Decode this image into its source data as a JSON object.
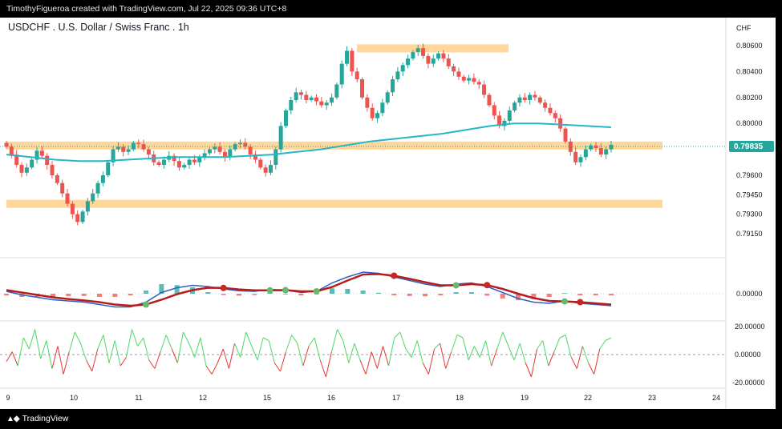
{
  "header": {
    "attribution": "TimothyFigueroa created with TradingView.com, Jul 22, 2025 09:36 UTC+8"
  },
  "footer": {
    "brand": "TradingView"
  },
  "chart_data": [
    {
      "type": "candlestick",
      "title": "USDCHF . U.S. Dollar / Swiss Franc . 1h",
      "currency_label": "CHF",
      "last_price_label": "0.79835",
      "y_tick_labels": [
        "0.80600",
        "0.80400",
        "0.80200",
        "0.80000",
        "0.79600",
        "0.79450",
        "0.79300",
        "0.79150"
      ],
      "x_tick_labels": [
        "9",
        "10",
        "11",
        "12",
        "15",
        "16",
        "17",
        "18",
        "19",
        "22",
        "23",
        "24"
      ],
      "ylim": [
        0.791,
        0.8068
      ],
      "colors": {
        "up": "#26a69a",
        "down": "#ef5350",
        "ma": "#26b7c7",
        "zone": "#ffd08a"
      },
      "zones": [
        [
          0.8057,
          0.8061
        ],
        [
          0.79805,
          0.7986
        ],
        [
          0.7937,
          0.7941
        ]
      ],
      "close": [
        0.7982,
        0.7976,
        0.7968,
        0.7962,
        0.7966,
        0.7972,
        0.7979,
        0.7975,
        0.7968,
        0.796,
        0.7954,
        0.7946,
        0.7938,
        0.793,
        0.7924,
        0.7932,
        0.794,
        0.7946,
        0.7954,
        0.796,
        0.797,
        0.798,
        0.7982,
        0.7978,
        0.798,
        0.7985,
        0.7984,
        0.798,
        0.7976,
        0.797,
        0.7968,
        0.7972,
        0.7975,
        0.7971,
        0.7966,
        0.7968,
        0.7972,
        0.797,
        0.7974,
        0.7977,
        0.798,
        0.7982,
        0.7978,
        0.7974,
        0.798,
        0.7984,
        0.7985,
        0.7982,
        0.7976,
        0.7972,
        0.7966,
        0.7962,
        0.7968,
        0.798,
        0.7998,
        0.801,
        0.8018,
        0.8024,
        0.8022,
        0.8018,
        0.802,
        0.8017,
        0.8014,
        0.8016,
        0.802,
        0.803,
        0.8046,
        0.8056,
        0.804,
        0.8034,
        0.802,
        0.8012,
        0.8004,
        0.8008,
        0.8016,
        0.8024,
        0.8034,
        0.804,
        0.8045,
        0.805,
        0.8055,
        0.8058,
        0.8052,
        0.8046,
        0.805,
        0.8054,
        0.805,
        0.8044,
        0.804,
        0.8036,
        0.8033,
        0.8035,
        0.8032,
        0.803,
        0.8022,
        0.8014,
        0.8006,
        0.7998,
        0.8002,
        0.801,
        0.8016,
        0.802,
        0.8018,
        0.8022,
        0.802,
        0.8016,
        0.8012,
        0.8008,
        0.8004,
        0.7996,
        0.7986,
        0.7978,
        0.797,
        0.7974,
        0.798,
        0.7983,
        0.7981,
        0.7976,
        0.798,
        0.79835
      ],
      "ma_values": [
        0.7976,
        0.7974,
        0.7972,
        0.7971,
        0.7971,
        0.7972,
        0.7973,
        0.7974,
        0.7974,
        0.7974,
        0.7975,
        0.7976,
        0.7978,
        0.798,
        0.7983,
        0.7986,
        0.7988,
        0.799,
        0.7992,
        0.7995,
        0.7998,
        0.8,
        0.8,
        0.7999,
        0.7998,
        0.7997
      ],
      "macd": [
        0.1,
        -0.05,
        -0.15,
        -0.25,
        -0.3,
        -0.35,
        -0.45,
        -0.55,
        -0.55,
        -0.35,
        0.05,
        0.25,
        0.35,
        0.3,
        0.2,
        0.12,
        0.1,
        0.18,
        0.15,
        0.05,
        0.1,
        0.45,
        0.7,
        0.9,
        0.85,
        0.7,
        0.55,
        0.4,
        0.3,
        0.4,
        0.45,
        0.3,
        0.05,
        -0.2,
        -0.35,
        -0.4,
        -0.3,
        -0.4,
        -0.45,
        -0.5
      ],
      "signal": [
        0.15,
        0.05,
        -0.05,
        -0.15,
        -0.22,
        -0.28,
        -0.35,
        -0.45,
        -0.5,
        -0.45,
        -0.25,
        -0.02,
        0.15,
        0.25,
        0.24,
        0.18,
        0.14,
        0.14,
        0.15,
        0.1,
        0.1,
        0.28,
        0.55,
        0.8,
        0.82,
        0.75,
        0.62,
        0.48,
        0.35,
        0.35,
        0.4,
        0.36,
        0.2,
        0.0,
        -0.18,
        -0.3,
        -0.32,
        -0.35,
        -0.4,
        -0.45
      ],
      "osc_axis_labels": [
        "20.00000",
        "0.00000",
        "-20.00000"
      ],
      "macd_axis_label": "0.00000",
      "oscillator": [
        -5,
        2,
        -8,
        12,
        4,
        18,
        -3,
        10,
        -10,
        6,
        -14,
        2,
        16,
        8,
        -4,
        -12,
        4,
        14,
        -6,
        10,
        -8,
        -2,
        18,
        6,
        12,
        -4,
        -10,
        2,
        14,
        4,
        -6,
        16,
        8,
        -2,
        12,
        -8,
        -14,
        -6,
        4,
        -10,
        8,
        -2,
        16,
        6,
        -4,
        12,
        10,
        -6,
        -12,
        2,
        14,
        8,
        -8,
        6,
        12,
        -4,
        -16,
        2,
        18,
        10,
        -6,
        8,
        -4,
        -14,
        2,
        -10,
        6,
        -8,
        12,
        16,
        4,
        -2,
        10,
        -6,
        -14,
        4,
        8,
        -10,
        2,
        14,
        12,
        -4,
        6,
        -2,
        10,
        -8,
        4,
        16,
        6,
        -4,
        8,
        -6,
        -16,
        4,
        10,
        -8,
        2,
        12,
        14,
        -2,
        -10,
        6,
        -6,
        -14,
        4,
        10,
        12
      ]
    }
  ]
}
